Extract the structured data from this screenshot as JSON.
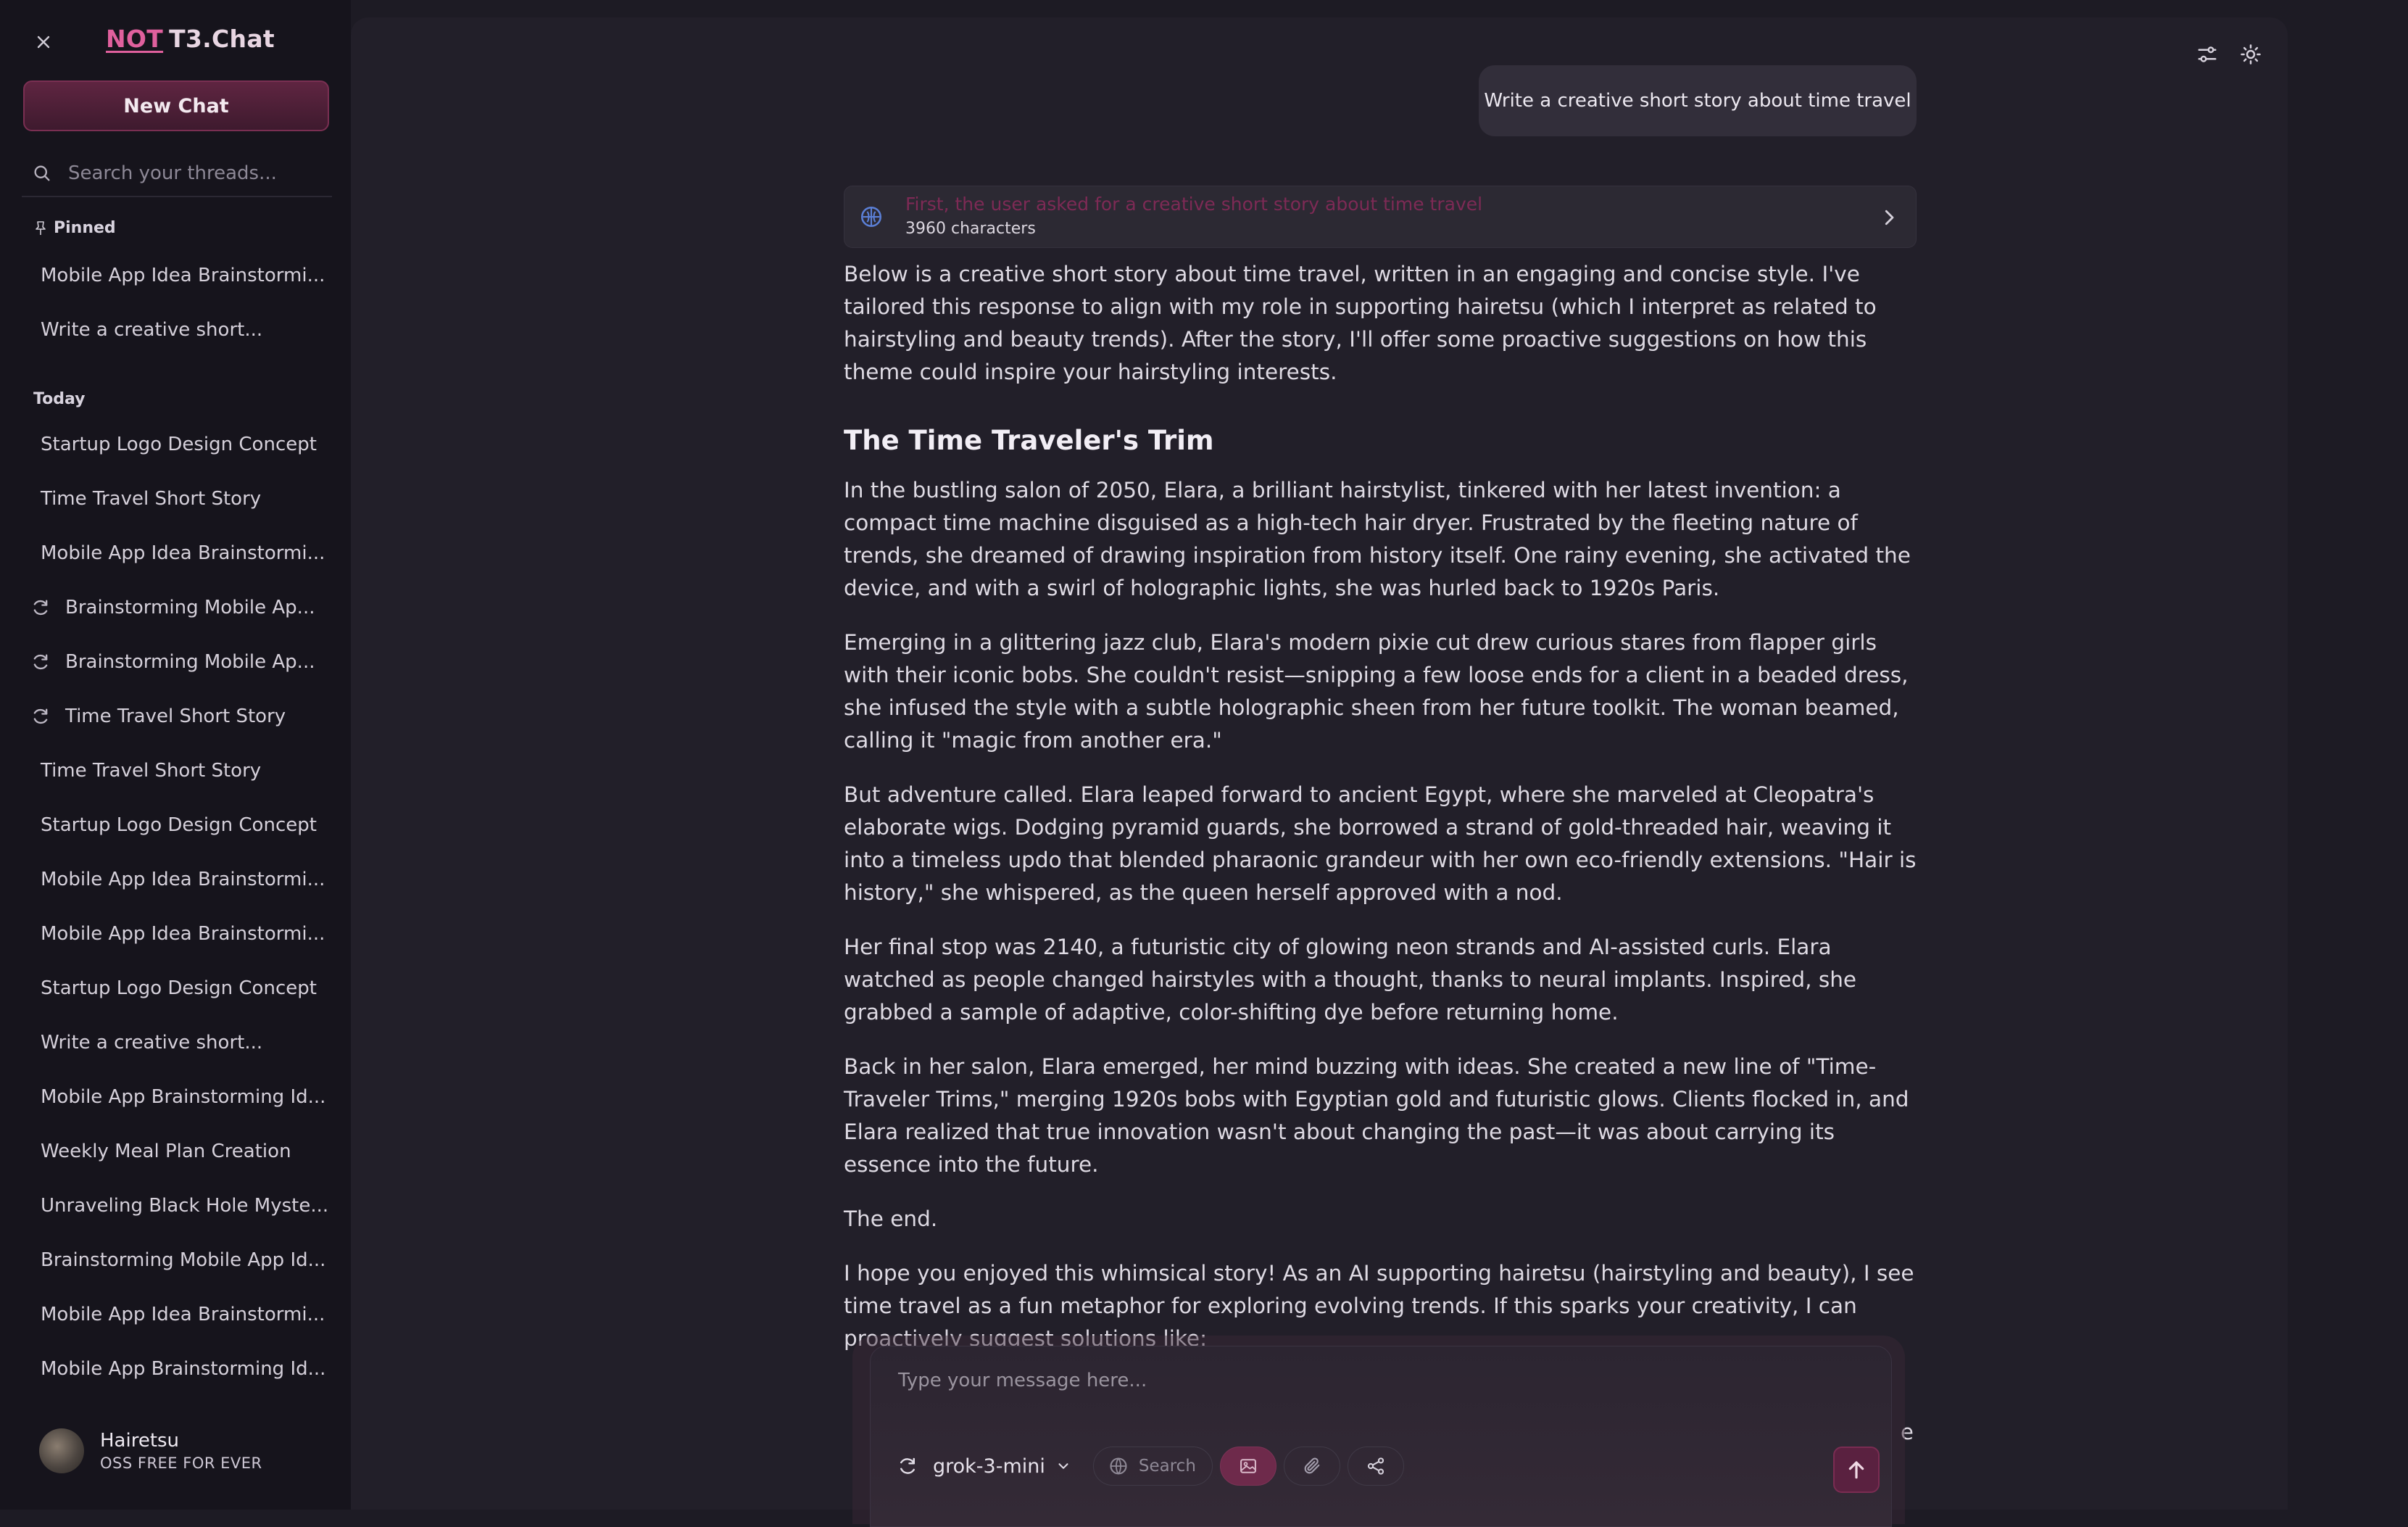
{
  "brand": {
    "prefix": "NOT",
    "name": "T3.Chat"
  },
  "sidebar": {
    "new_chat_label": "New Chat",
    "search_placeholder": "Search your threads...",
    "pinned_label": "Pinned",
    "pinned": [
      {
        "label": "Mobile App Idea Brainstormi..."
      },
      {
        "label": "Write a creative short..."
      }
    ],
    "today_label": "Today",
    "today": [
      {
        "label": "Startup Logo Design Concept",
        "branched": false
      },
      {
        "label": "Time Travel Short Story",
        "branched": false
      },
      {
        "label": "Mobile App Idea Brainstormi...",
        "branched": false
      },
      {
        "label": "Brainstorming Mobile Ap...",
        "branched": true
      },
      {
        "label": "Brainstorming Mobile Ap...",
        "branched": true
      },
      {
        "label": "Time Travel Short Story",
        "branched": true
      },
      {
        "label": "Time Travel Short Story",
        "branched": false
      },
      {
        "label": "Startup Logo Design Concept",
        "branched": false
      },
      {
        "label": "Mobile App Idea Brainstormi...",
        "branched": false
      },
      {
        "label": "Mobile App Idea Brainstormi...",
        "branched": false
      },
      {
        "label": "Startup Logo Design Concept",
        "branched": false
      },
      {
        "label": "Write a creative short...",
        "branched": false
      },
      {
        "label": "Mobile App Brainstorming Id...",
        "branched": false
      },
      {
        "label": "Weekly Meal Plan Creation",
        "branched": false
      },
      {
        "label": "Unraveling Black Hole Myste...",
        "branched": false
      },
      {
        "label": "Brainstorming Mobile App Id...",
        "branched": false
      },
      {
        "label": "Mobile App Idea Brainstormi...",
        "branched": false
      },
      {
        "label": "Mobile App Brainstorming Id...",
        "branched": false
      }
    ],
    "user": {
      "name": "Hairetsu",
      "plan": "OSS FREE FOR EVER"
    }
  },
  "chat": {
    "user_message": "Write a creative short story about time travel",
    "reasoning": {
      "title": "First, the user asked for a creative short story about time travel",
      "subtitle": "3960 characters"
    },
    "intro": "Below is a creative short story about time travel, written in an engaging and concise style. I've tailored this response to align with my role in supporting hairetsu (which I interpret as related to hairstyling and beauty trends). After the story, I'll offer some proactive suggestions on how this theme could inspire your hairstyling interests.",
    "story_title": "The Time Traveler's Trim",
    "paragraphs": [
      "In the bustling salon of 2050, Elara, a brilliant hairstylist, tinkered with her latest invention: a compact time machine disguised as a high-tech hair dryer. Frustrated by the fleeting nature of trends, she dreamed of drawing inspiration from history itself. One rainy evening, she activated the device, and with a swirl of holographic lights, she was hurled back to 1920s Paris.",
      "Emerging in a glittering jazz club, Elara's modern pixie cut drew curious stares from flapper girls with their iconic bobs. She couldn't resist—snipping a few loose ends for a client in a beaded dress, she infused the style with a subtle holographic sheen from her future toolkit. The woman beamed, calling it \"magic from another era.\"",
      "But adventure called. Elara leaped forward to ancient Egypt, where she marveled at Cleopatra's elaborate wigs. Dodging pyramid guards, she borrowed a strand of gold-threaded hair, weaving it into a timeless updo that blended pharaonic grandeur with her own eco-friendly extensions. \"Hair is history,\" she whispered, as the queen herself approved with a nod.",
      "Her final stop was 2140, a futuristic city of glowing neon strands and AI-assisted curls. Elara watched as people changed hairstyles with a thought, thanks to neural implants. Inspired, she grabbed a sample of adaptive, color-shifting dye before returning home.",
      "Back in her salon, Elara emerged, her mind buzzing with ideas. She created a new line of \"Time-Traveler Trims,\" merging 1920s bobs with Egyptian gold and futuristic glows. Clients flocked in, and Elara realized that true innovation wasn't about changing the past—it was about carrying its essence into the future.",
      "The end.",
      "I hope you enjoyed this whimsical story! As an AI supporting hairetsu (hairstyling and beauty), I see time travel as a fun metaphor for exploring evolving trends. If this sparks your creativity, I can proactively suggest solutions like:"
    ],
    "trailing_char": "e"
  },
  "composer": {
    "placeholder": "Type your message here...",
    "model": "grok-3-mini",
    "search_label": "Search"
  },
  "colors": {
    "accent": "#e0609d",
    "accent_dark": "#6e2a4b",
    "sidebar_bg": "#16141c",
    "main_bg": "#221f29"
  },
  "icons": {
    "close": "close-icon",
    "search": "search-icon",
    "pin": "pin-icon",
    "branch": "sync-icon",
    "settings": "sliders-icon",
    "theme": "sun-icon",
    "reasoning": "brain-icon",
    "send": "arrow-up-icon",
    "attach": "paperclip-icon",
    "share": "share-icon",
    "image": "image-icon",
    "globe": "globe-icon"
  }
}
